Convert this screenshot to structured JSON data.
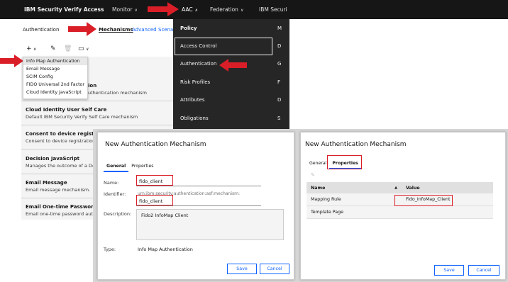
{
  "topbar": {
    "brand": "IBM Security Verify Access",
    "nav": [
      {
        "label": "Monitor"
      },
      {
        "label": "AAC"
      },
      {
        "label": "Federation"
      },
      {
        "label": "IBM Securi"
      }
    ]
  },
  "subnav": {
    "title": "Authentication",
    "tabs": [
      "Mechanisms",
      "Advanced",
      "Scena"
    ]
  },
  "dropdown": {
    "items": [
      "Info Map Authentication",
      "Email Message",
      "SCIM Config",
      "FIDO Universal 2nd Factor",
      "Cloud Identity JavaScript"
    ]
  },
  "mechanisms": {
    "partial_item": {
      "title": "ion",
      "desc": "uthentication mechanism"
    },
    "items": [
      {
        "title": "Cloud Identity User Self Care",
        "desc": "Default IBM Security Verify Self Care mechanism"
      },
      {
        "title": "Consent to device registration",
        "desc": "Consent to device registration a"
      },
      {
        "title": "Decision JavaScript",
        "desc": "Manages the outcome of a Deci"
      },
      {
        "title": "Email Message",
        "desc": "Email message mechanism."
      },
      {
        "title": "Email One-time Password",
        "desc": "Email one-time password authe"
      }
    ]
  },
  "aac_menu": {
    "items": [
      "Policy",
      "Access Control",
      "Authentication",
      "Risk Profiles",
      "Attributes",
      "Obligations"
    ],
    "side_letters": [
      "M",
      "D",
      "G",
      "F",
      "D",
      "S"
    ]
  },
  "dialog_general": {
    "title": "New Authentication Mechanism",
    "tabs": [
      "General",
      "Properties"
    ],
    "name_label": "Name:",
    "name_value": "fido_client",
    "identifier_label": "Identifier:",
    "identifier_prefix": "urn:ibm:security:authentication:asf:mechanism:",
    "identifier_value": "fido_client",
    "description_label": "Description:",
    "description_value": "Fido2 InfoMap Client",
    "type_label": "Type:",
    "type_value": "Info Map Authentication",
    "save_label": "Save",
    "cancel_label": "Cancel"
  },
  "dialog_properties": {
    "title": "New Authentication Mechanism",
    "tabs": [
      "General",
      "Properties"
    ],
    "columns": [
      "Name",
      "Value"
    ],
    "sort_glyph": "▲",
    "rows": [
      {
        "name": "Mapping Rule",
        "value": "Fido_InfoMap_Client"
      },
      {
        "name": "Template Page",
        "value": ""
      }
    ],
    "save_label": "Save",
    "cancel_label": "Cancel"
  },
  "colors": {
    "accent": "#0f62fe",
    "annotation": "#da1e28",
    "topbar": "#161616",
    "menu": "#262626"
  }
}
